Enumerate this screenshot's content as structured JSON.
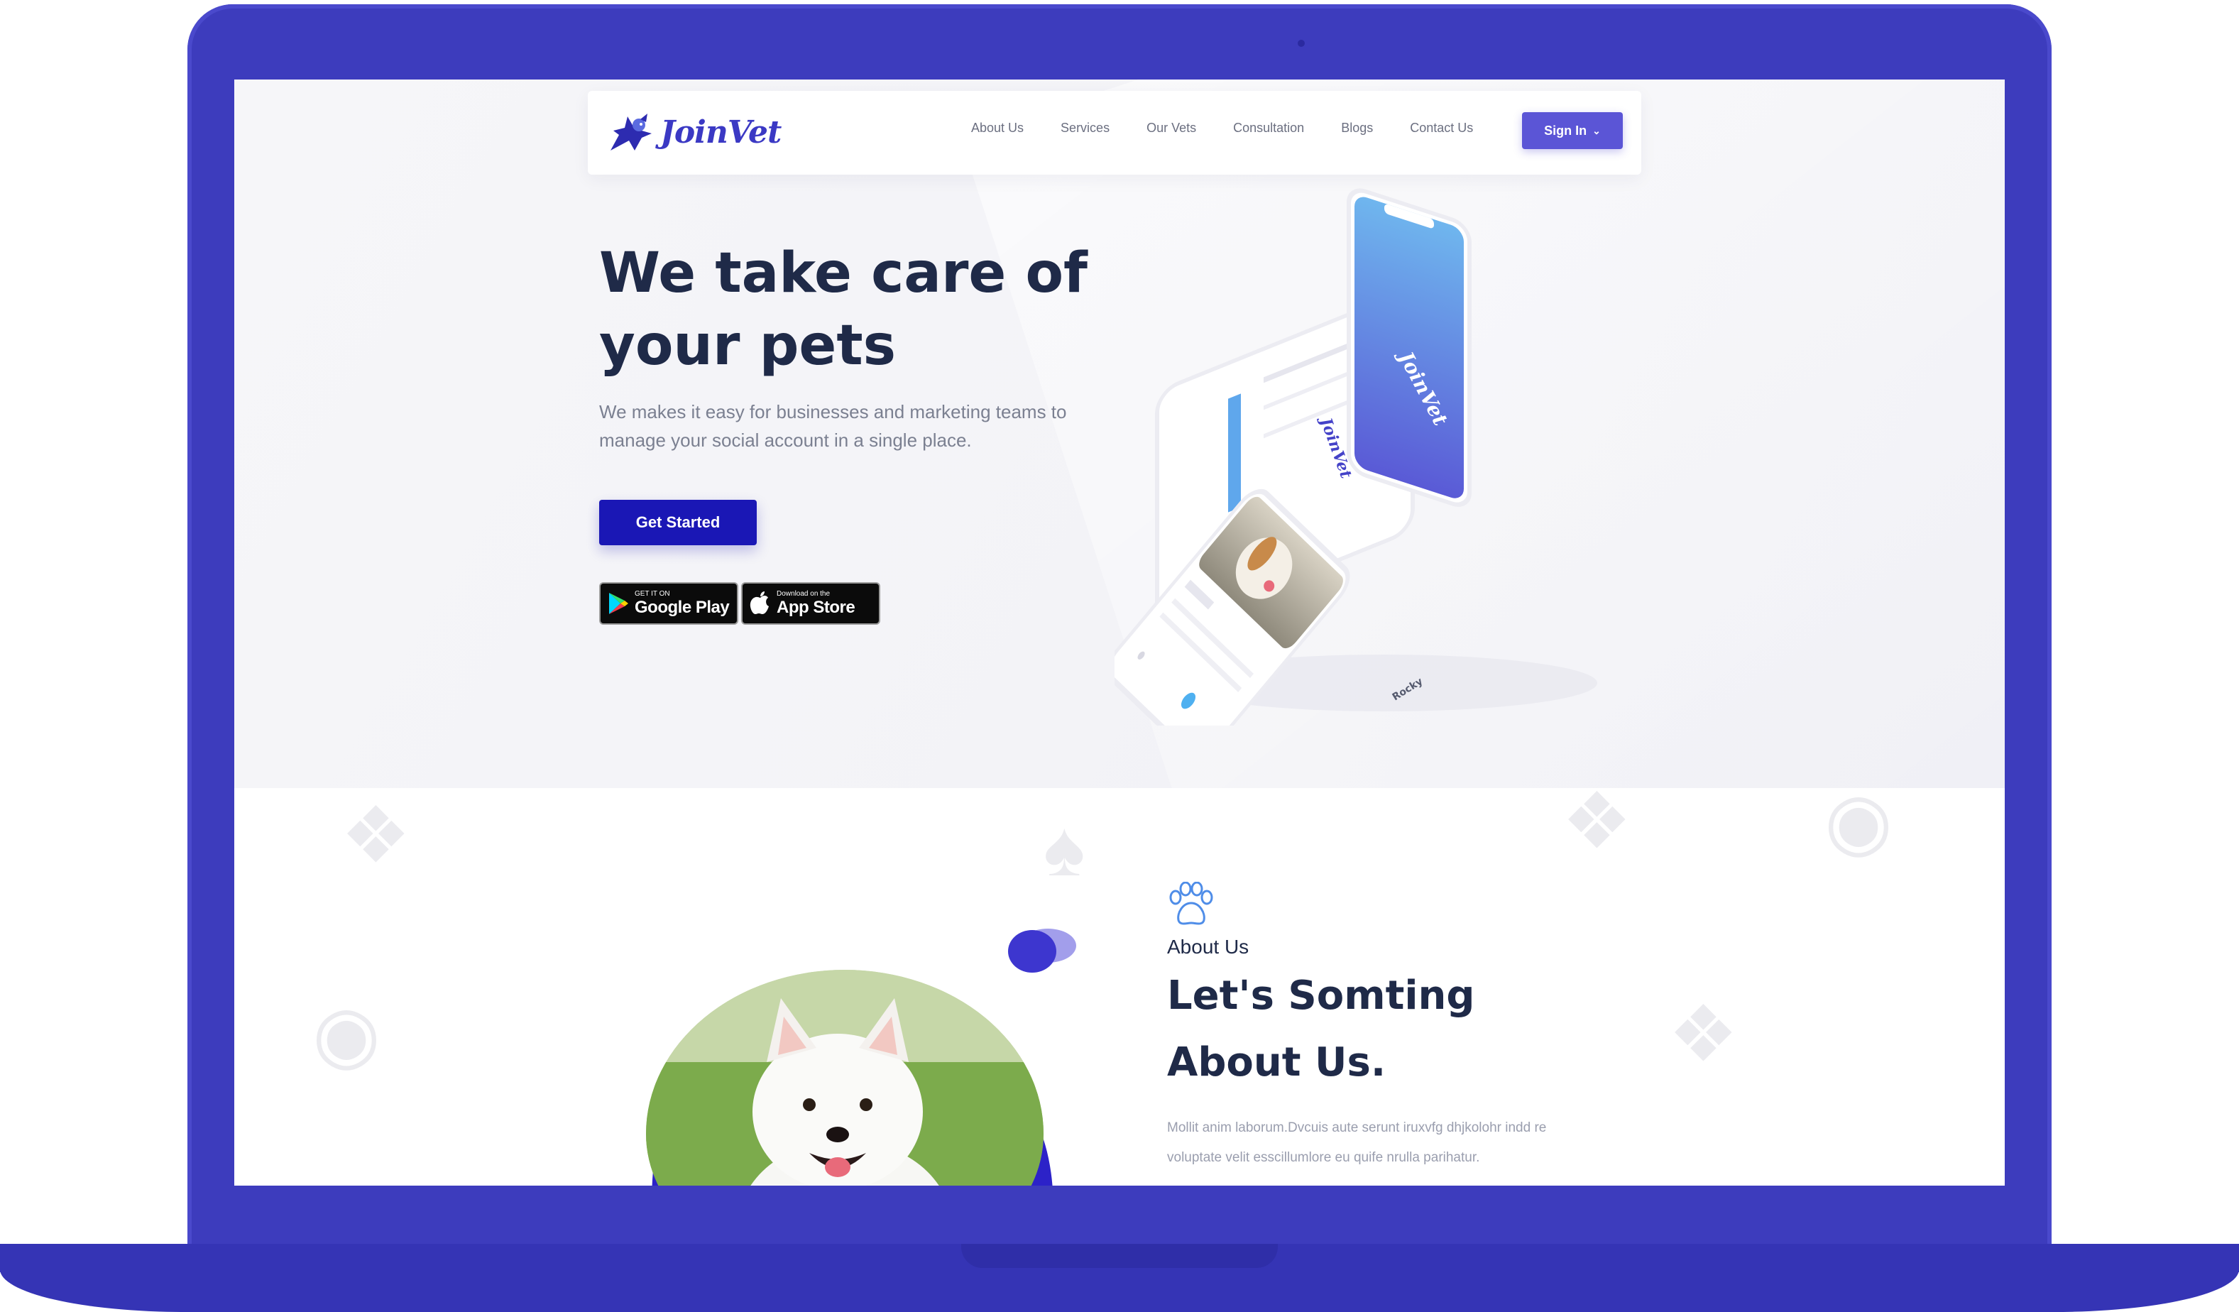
{
  "colors": {
    "laptop_frame": "#3d3cbd",
    "brand": "#3b39c4",
    "primary_button": "#1a17b5",
    "signin_button": "#5b55d6",
    "heading": "#1f2a48"
  },
  "navbar": {
    "logo_text": "JoinVet",
    "links": [
      "About Us",
      "Services",
      "Our Vets",
      "Consultation",
      "Blogs",
      "Contact Us"
    ],
    "signin_label": "Sign In",
    "signin_icon": "chevron-down-icon"
  },
  "hero": {
    "title": "We take care of\nyour pets",
    "subtitle": "We makes it easy for businesses and marketing teams to\nmanage your social account in a single place.",
    "cta_label": "Get Started",
    "google_play": {
      "small": "GET IT ON",
      "big": "Google Play"
    },
    "app_store": {
      "small": "Download on the",
      "big": "App Store"
    },
    "phone_splash_text": "JoinVet",
    "phone_pet_name": "Rocky"
  },
  "about": {
    "eyebrow": "About Us",
    "title": "Let's Somting\nAbout Us.",
    "text": "Mollit anim laborum.Dvcuis aute serunt iruxvfg dhjkolohr indd re\nvoluptate velit esscillumlore eu quife nrulla parihatur."
  }
}
